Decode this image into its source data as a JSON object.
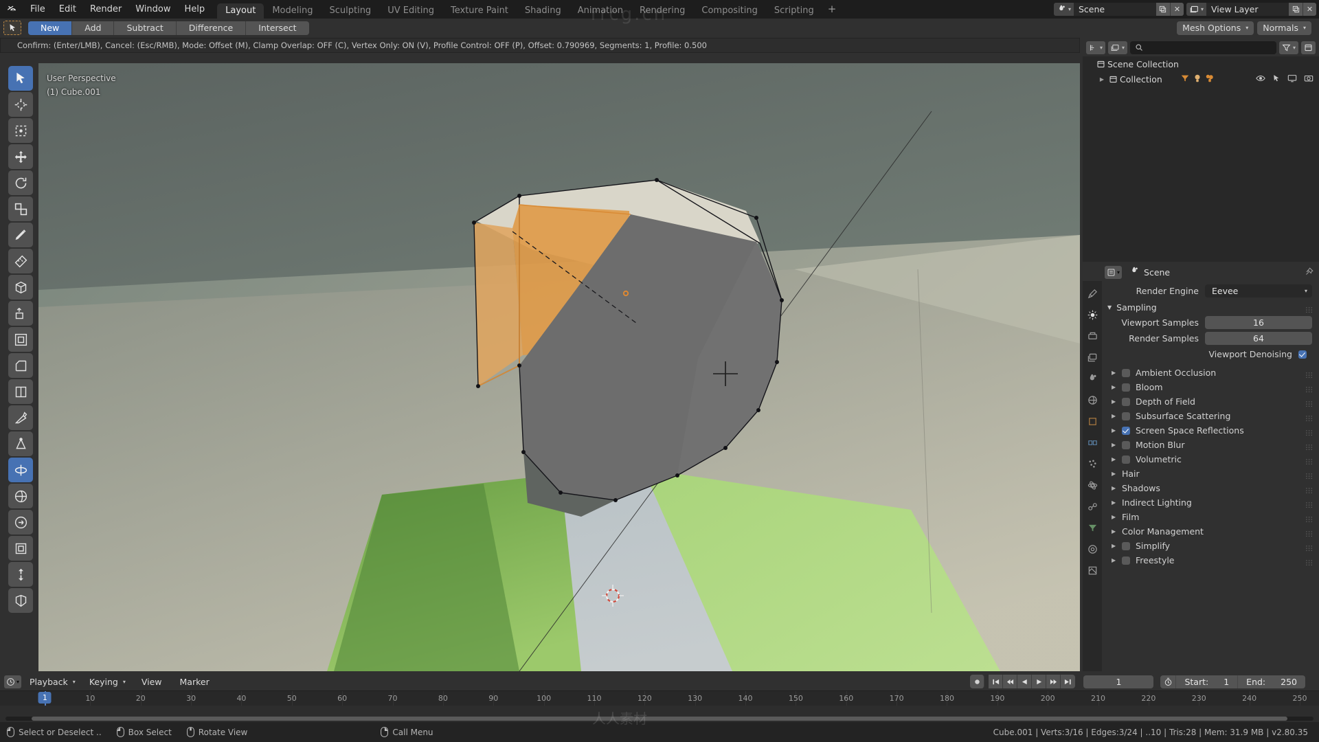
{
  "topbar": {
    "logo_icon": "blender-logo-icon",
    "menus": [
      "File",
      "Edit",
      "Render",
      "Window",
      "Help"
    ],
    "workspaces": [
      {
        "label": "Layout",
        "active": true
      },
      {
        "label": "Modeling",
        "active": false
      },
      {
        "label": "Sculpting",
        "active": false
      },
      {
        "label": "UV Editing",
        "active": false
      },
      {
        "label": "Texture Paint",
        "active": false
      },
      {
        "label": "Shading",
        "active": false
      },
      {
        "label": "Animation",
        "active": false
      },
      {
        "label": "Rendering",
        "active": false
      },
      {
        "label": "Compositing",
        "active": false
      },
      {
        "label": "Scripting",
        "active": false
      }
    ],
    "add_workspace_label": "+",
    "scene": {
      "icon": "scene-icon",
      "name": "Scene",
      "new_icon": "new-copy-icon",
      "unlink_icon": "x-icon"
    },
    "view_layer": {
      "icon": "view-layer-icon",
      "name": "View Layer",
      "new_icon": "new-copy-icon",
      "unlink_icon": "x-icon"
    }
  },
  "tool_header": {
    "active_tool_icon": "cursor-select-icon",
    "boolean_modes": [
      {
        "label": "New",
        "active": true
      },
      {
        "label": "Add",
        "active": false
      },
      {
        "label": "Subtract",
        "active": false
      },
      {
        "label": "Difference",
        "active": false
      },
      {
        "label": "Intersect",
        "active": false
      }
    ],
    "right_dropdowns": [
      "Mesh Options",
      "Normals"
    ]
  },
  "operator_info": "Confirm: (Enter/LMB), Cancel: (Esc/RMB), Mode: Offset (M), Clamp Overlap: OFF (C), Vertex Only: ON (V), Profile Control: OFF (P), Offset: 0.790969, Segments: 1, Profile: 0.500",
  "viewport": {
    "view_name": "User Perspective",
    "object_info": "(1) Cube.001",
    "toolbar_icons": [
      "tweak-select-icon",
      "cursor-icon",
      "select-box-icon",
      "move-icon",
      "rotate-icon",
      "scale-icon",
      "transform-icon",
      "annotate-icon",
      "measure-icon",
      "add-cube-icon",
      "extrude-region-icon",
      "inset-faces-icon",
      "bevel-icon",
      "loop-cut-icon",
      "knife-icon",
      "poly-build-icon",
      "spin-icon",
      "smooth-icon",
      "edge-slide-icon",
      "shrink-fatten-icon",
      "shear-icon",
      "rip-region-icon"
    ]
  },
  "outliner": {
    "display_mode_icon": "outliner-mode-icon",
    "filter_icon": "view-layer-icon",
    "search_placeholder": "",
    "search_icon": "search-icon",
    "filter_funnel_icon": "filter-icon",
    "new_collection_icon": "new-collection-icon",
    "rows": [
      {
        "label": "Scene Collection",
        "icon": "collection-icon",
        "indent": 0,
        "expandable": false
      },
      {
        "label": "Collection",
        "icon": "collection-icon",
        "indent": 1,
        "expandable": true,
        "content_icons": [
          "mesh-data-icon",
          "light-icon",
          "camera-icon"
        ],
        "restrict_icons": [
          "eye-icon",
          "cursor-select-icon",
          "screen-icon",
          "camera-render-icon"
        ]
      }
    ]
  },
  "properties": {
    "editor_icon": "properties-editor-icon",
    "tabs": [
      "tool-icon",
      "render-icon",
      "output-icon",
      "view-layer-icon",
      "scene-icon",
      "world-icon",
      "object-icon",
      "modifier-icon",
      "particles-icon",
      "physics-icon",
      "constraint-icon",
      "data-icon",
      "material-icon",
      "texture-icon"
    ],
    "active_tab": "render-icon",
    "breadcrumb_icon": "scene-icon",
    "breadcrumb": "Scene",
    "pin_icon": "pin-icon",
    "render_engine": {
      "label": "Render Engine",
      "value": "Eevee"
    },
    "sampling": {
      "title": "Sampling",
      "expanded": true,
      "rows": [
        {
          "label": "Viewport Samples",
          "value": "16"
        },
        {
          "label": "Render Samples",
          "value": "64"
        }
      ],
      "checkbox": {
        "label": "Viewport Denoising",
        "checked": true
      }
    },
    "sections": [
      {
        "label": "Ambient Occlusion",
        "checkbox": true,
        "checked": false
      },
      {
        "label": "Bloom",
        "checkbox": true,
        "checked": false
      },
      {
        "label": "Depth of Field",
        "checkbox": true,
        "checked": false
      },
      {
        "label": "Subsurface Scattering",
        "checkbox": true,
        "checked": false
      },
      {
        "label": "Screen Space Reflections",
        "checkbox": true,
        "checked": true
      },
      {
        "label": "Motion Blur",
        "checkbox": true,
        "checked": false
      },
      {
        "label": "Volumetric",
        "checkbox": true,
        "checked": false
      },
      {
        "label": "Hair",
        "checkbox": false,
        "checked": false
      },
      {
        "label": "Shadows",
        "checkbox": false,
        "checked": false
      },
      {
        "label": "Indirect Lighting",
        "checkbox": false,
        "checked": false
      },
      {
        "label": "Film",
        "checkbox": false,
        "checked": false
      },
      {
        "label": "Color Management",
        "checkbox": false,
        "checked": false
      },
      {
        "label": "Simplify",
        "checkbox": true,
        "checked": false
      },
      {
        "label": "Freestyle",
        "checkbox": true,
        "checked": false
      }
    ]
  },
  "timeline": {
    "editor_icon": "timeline-editor-icon",
    "menus": [
      "Playback",
      "Keying",
      "View",
      "Marker"
    ],
    "playback_buttons": [
      "record-icon",
      "jump-start-icon",
      "prev-keyframe-icon",
      "play-reverse-icon",
      "play-icon",
      "next-keyframe-icon",
      "jump-end-icon"
    ],
    "current_frame": "1",
    "auto_key_icon": "clock-icon",
    "start_label": "Start:",
    "start_value": "1",
    "end_label": "End:",
    "end_value": "250",
    "playhead_label": "1",
    "ruler_ticks": [
      "10",
      "20",
      "30",
      "40",
      "50",
      "60",
      "70",
      "80",
      "90",
      "100",
      "110",
      "120",
      "130",
      "140",
      "150",
      "160",
      "170",
      "180",
      "190",
      "200",
      "210",
      "220",
      "230",
      "240",
      "250"
    ]
  },
  "statusbar": {
    "hints": [
      {
        "icon": "mouse-left-icon",
        "label": "Select or Deselect .."
      },
      {
        "icon": "mouse-left-drag-icon",
        "label": "Box Select"
      },
      {
        "icon": "mouse-middle-icon",
        "label": "Rotate View"
      },
      {
        "icon": "mouse-right-icon",
        "label": "Call Menu"
      }
    ],
    "stats": "Cube.001 | Verts:3/16 | Edges:3/24 | ..10 | Tris:28 | Mem: 31.9 MB | v2.80.35"
  },
  "colors": {
    "accent_blue": "#4772b3",
    "panel_bg": "#303030",
    "dark_bg": "#1d1d1d",
    "field_bg": "#545454",
    "selected_orange": "#e08a30"
  }
}
